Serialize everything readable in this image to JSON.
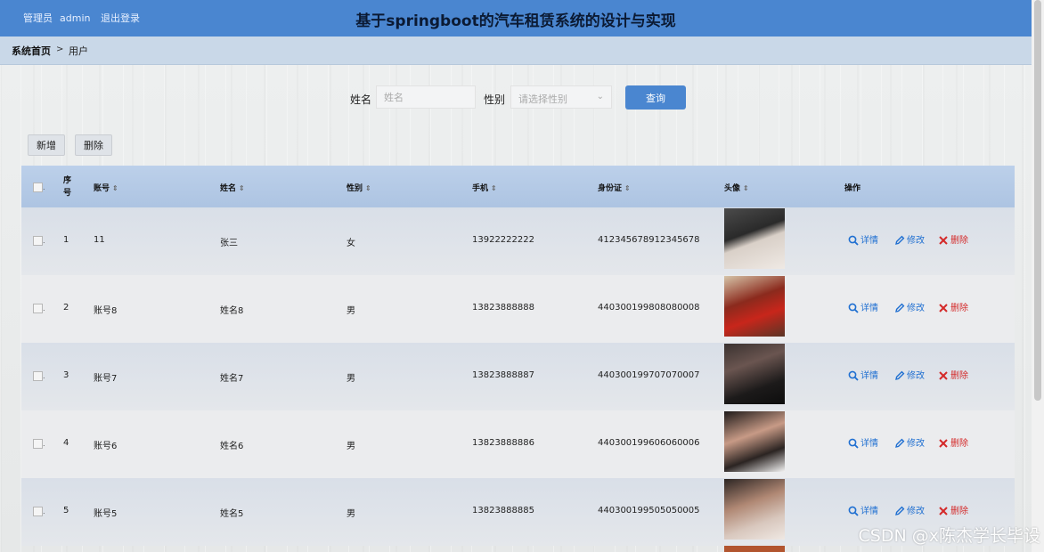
{
  "header": {
    "role": "管理员",
    "username": "admin",
    "logout": "退出登录",
    "title": "基于springboot的汽车租赁系统的设计与实现"
  },
  "breadcrumb": {
    "home": "系统首页",
    "sep": ">",
    "current": "用户"
  },
  "search": {
    "name_label": "姓名",
    "name_placeholder": "姓名",
    "gender_label": "性别",
    "gender_placeholder": "请选择性别",
    "query_button": "查询"
  },
  "toolbar": {
    "add": "新增",
    "delete": "删除"
  },
  "table": {
    "columns": [
      "序号",
      "账号",
      "姓名",
      "性别",
      "手机",
      "身份证",
      "头像",
      "操作"
    ],
    "rows": [
      {
        "no": "1",
        "account": "11",
        "name": "张三",
        "gender": "女",
        "phone": "13922222222",
        "idcard": "412345678912345678"
      },
      {
        "no": "2",
        "account": "账号8",
        "name": "姓名8",
        "gender": "男",
        "phone": "13823888888",
        "idcard": "440300199808080008"
      },
      {
        "no": "3",
        "account": "账号7",
        "name": "姓名7",
        "gender": "男",
        "phone": "13823888887",
        "idcard": "440300199707070007"
      },
      {
        "no": "4",
        "account": "账号6",
        "name": "姓名6",
        "gender": "男",
        "phone": "13823888886",
        "idcard": "440300199606060006"
      },
      {
        "no": "5",
        "account": "账号5",
        "name": "姓名5",
        "gender": "男",
        "phone": "13823888885",
        "idcard": "440300199505050005"
      }
    ],
    "actions": {
      "detail": "详情",
      "edit": "修改",
      "delete": "删除"
    }
  },
  "watermark": "CSDN @x陈杰学长毕设",
  "colors": {
    "header": "#4a86d0",
    "breadcrumb": "#c9d8e8",
    "link": "#1f6fd1",
    "danger": "#d42a2a"
  }
}
